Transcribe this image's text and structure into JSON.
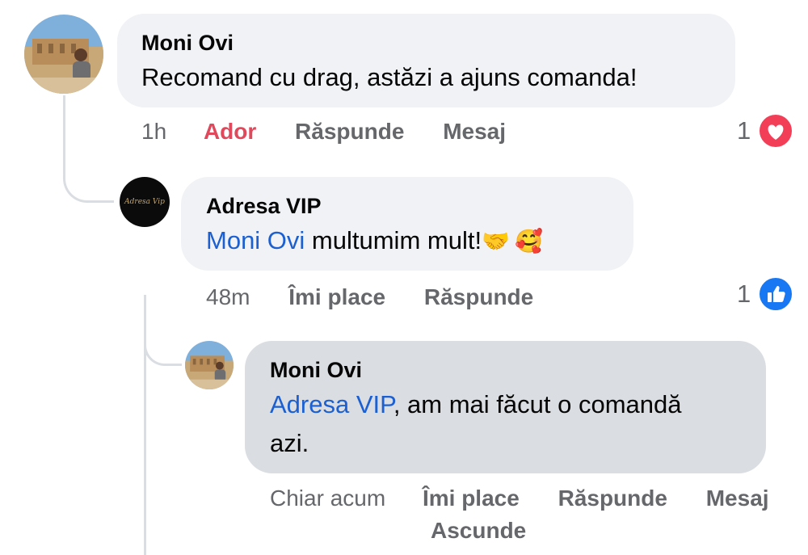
{
  "comments": [
    {
      "author": "Moni Ovi",
      "text": "Recomand cu drag, astăzi a ajuns comanda!",
      "time": "1h",
      "actions": [
        "Ador",
        "Răspunde",
        "Mesaj"
      ],
      "reaction_count": "1",
      "reaction_icon": "heart-icon"
    },
    {
      "author": "Adresa VIP",
      "mention": "Moni Ovi",
      "text": " multumim mult!",
      "emoji": [
        "🤝",
        "🥰"
      ],
      "time": "48m",
      "actions": [
        "Îmi place",
        "Răspunde"
      ],
      "reaction_count": "1",
      "reaction_icon": "like-icon",
      "avatar_text": "Adresa Vip"
    },
    {
      "author": "Moni Ovi",
      "mention": "Adresa VIP",
      "text_line1": ", am mai făcut o comandă",
      "text_line2": "azi.",
      "time": "Chiar acum",
      "actions": [
        "Îmi place",
        "Răspunde",
        "Mesaj"
      ],
      "hide_action": "Ascunde"
    }
  ],
  "colors": {
    "loved": "#e0485c",
    "mention": "#1b5fd1",
    "heart_reaction": "#f33e58",
    "like_reaction": "#1877f2"
  }
}
